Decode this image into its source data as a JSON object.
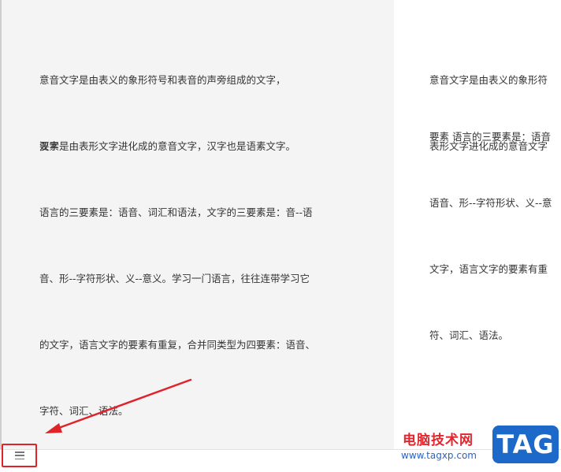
{
  "left_page": {
    "paragraph1": [
      "意音文字是由表义的象形符号和表音的声旁组成的文字，",
      "汉字是由表形文字进化成的意音文字，汉字也是语素文字。"
    ],
    "heading": "要素",
    "paragraph2": [
      "语言的三要素是：语音、词汇和语法，文字的三要素是：音--语",
      "音、形--字符形状、义--意义。学习一门语言，往往连带学习它",
      "的文字，语言文字的要素有重复，合并同类型为四要素：语音、",
      "字符、词汇、语法。"
    ]
  },
  "right_page": {
    "paragraph1": [
      "意音文字是由表义的象形符",
      "表形文字进化成的意音文字"
    ],
    "paragraph2": [
      "要素 语言的三要素是：语音",
      "语音、形--字符形状、义--意",
      "文字，语言文字的要素有重",
      "符、词汇、语法。"
    ]
  },
  "bottom_bar": {
    "menu_icon": "hamburger-menu-icon"
  },
  "watermark": {
    "site_name": "电脑技术网",
    "url": "www.tagxp.com",
    "badge": "TAG"
  },
  "colors": {
    "highlight_border": "#e0222a",
    "arrow": "#e0222a",
    "watermark_red": "#e1262d",
    "watermark_blue": "#1d69c9"
  }
}
